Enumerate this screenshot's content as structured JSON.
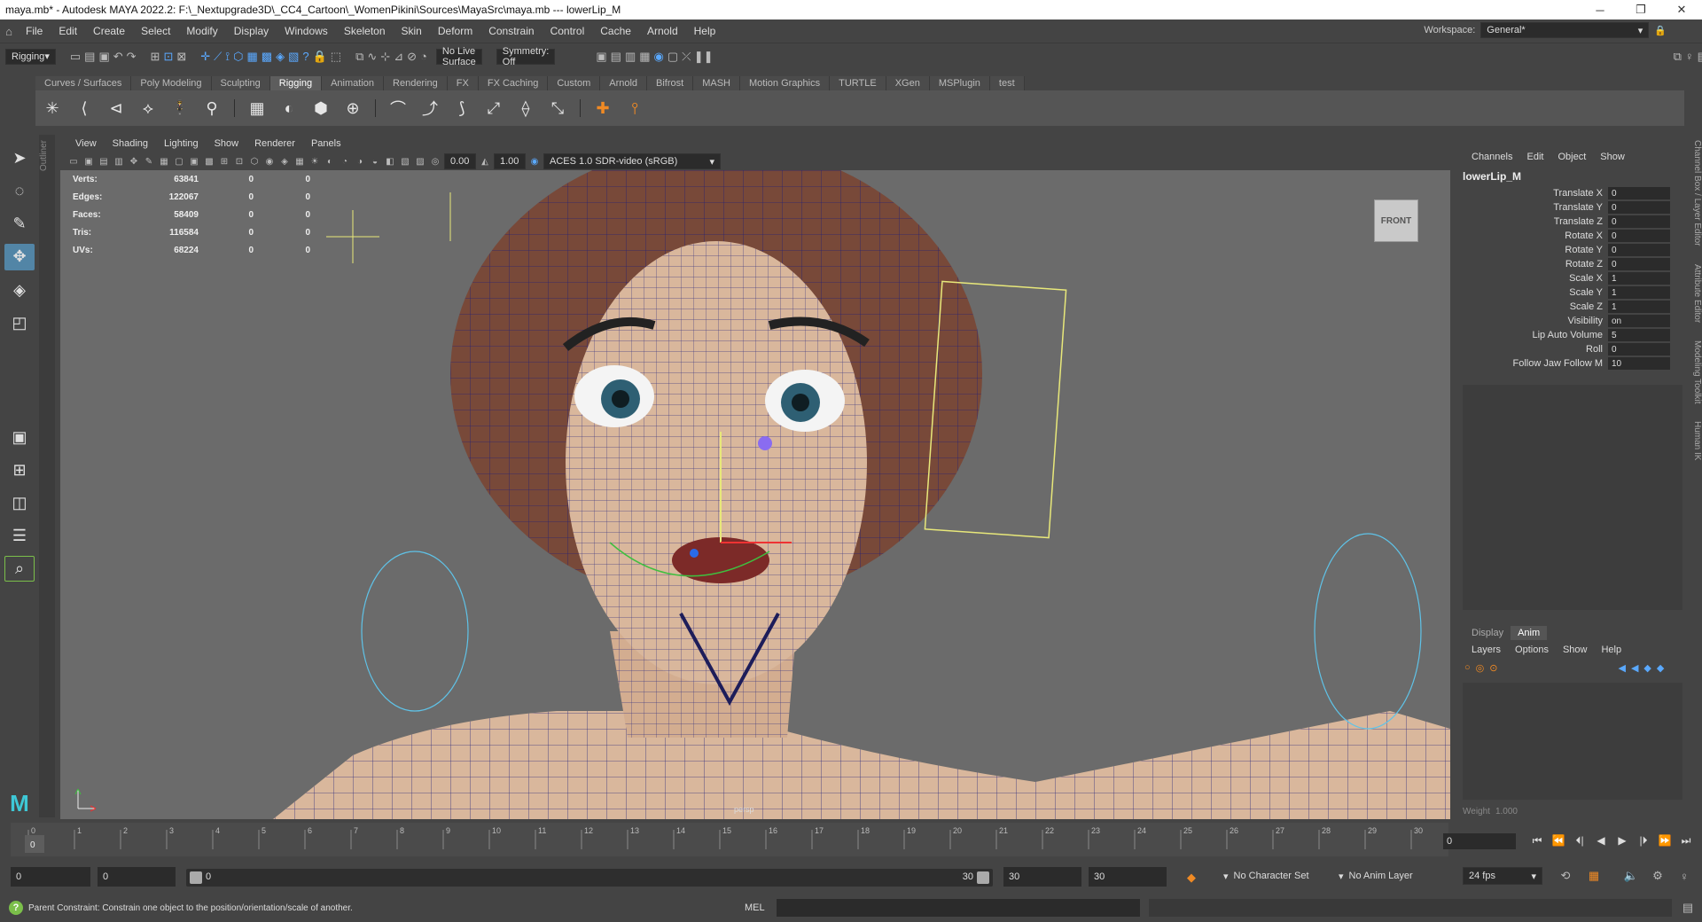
{
  "titlebar": {
    "title": "maya.mb* - Autodesk MAYA 2022.2: F:\\_Nextupgrade3D\\_CC4_Cartoon\\_WomenPikini\\Sources\\MayaSrc\\maya.mb   ---   lowerLip_M",
    "min": "─",
    "max": "❐",
    "close": "✕"
  },
  "menu": [
    "File",
    "Edit",
    "Create",
    "Select",
    "Modify",
    "Display",
    "Windows",
    "Skeleton",
    "Skin",
    "Deform",
    "Constrain",
    "Control",
    "Cache",
    "Arnold",
    "Help"
  ],
  "workspace": {
    "label": "Workspace:",
    "value": "General*"
  },
  "status": {
    "mode": "Rigging",
    "live_surface": "No Live Surface",
    "symmetry": "Symmetry: Off"
  },
  "shelf_tabs": [
    "Curves / Surfaces",
    "Poly Modeling",
    "Sculpting",
    "Rigging",
    "Animation",
    "Rendering",
    "FX",
    "FX Caching",
    "Custom",
    "Arnold",
    "Bifrost",
    "MASH",
    "Motion Graphics",
    "TURTLE",
    "XGen",
    "MSPlugin",
    "test"
  ],
  "shelf_active": "Rigging",
  "outliner_label": "Outliner",
  "panel_menu": [
    "View",
    "Shading",
    "Lighting",
    "Show",
    "Renderer",
    "Panels"
  ],
  "panel_toolbar": {
    "exposure": "0.00",
    "gamma": "1.00",
    "colorspace": "ACES 1.0 SDR-video (sRGB)"
  },
  "hud": [
    {
      "label": "Verts:",
      "a": "63841",
      "b": "0",
      "c": "0"
    },
    {
      "label": "Edges:",
      "a": "122067",
      "b": "0",
      "c": "0"
    },
    {
      "label": "Faces:",
      "a": "58409",
      "b": "0",
      "c": "0"
    },
    {
      "label": "Tris:",
      "a": "116584",
      "b": "0",
      "c": "0"
    },
    {
      "label": "UVs:",
      "a": "68224",
      "b": "0",
      "c": "0"
    }
  ],
  "viewcube": "FRONT",
  "camera": "persp",
  "channelbox": {
    "tabs": [
      "Channels",
      "Edit",
      "Object",
      "Show"
    ],
    "object": "lowerLip_M",
    "attrs": [
      {
        "name": "Translate X",
        "value": "0"
      },
      {
        "name": "Translate Y",
        "value": "0"
      },
      {
        "name": "Translate Z",
        "value": "0"
      },
      {
        "name": "Rotate X",
        "value": "0"
      },
      {
        "name": "Rotate Y",
        "value": "0"
      },
      {
        "name": "Rotate Z",
        "value": "0"
      },
      {
        "name": "Scale X",
        "value": "1"
      },
      {
        "name": "Scale Y",
        "value": "1"
      },
      {
        "name": "Scale Z",
        "value": "1"
      },
      {
        "name": "Visibility",
        "value": "on"
      },
      {
        "name": "Lip Auto Volume",
        "value": "5"
      },
      {
        "name": "Roll",
        "value": "0"
      },
      {
        "name": "Follow Jaw Follow M",
        "value": "10"
      }
    ]
  },
  "side_tabs": [
    "Channel Box / Layer Editor",
    "Attribute Editor",
    "Modeling Toolkit",
    "Human IK"
  ],
  "layers": {
    "tabs": [
      "Display",
      "Anim"
    ],
    "active": "Anim",
    "menu": [
      "Layers",
      "Options",
      "Show",
      "Help"
    ],
    "weight_label": "Weight",
    "weight_value": "1.000"
  },
  "timeline": {
    "ticks": [
      "0",
      "1",
      "2",
      "3",
      "4",
      "5",
      "6",
      "7",
      "8",
      "9",
      "10",
      "11",
      "12",
      "13",
      "14",
      "15",
      "16",
      "17",
      "18",
      "19",
      "20",
      "21",
      "22",
      "23",
      "24",
      "25",
      "26",
      "27",
      "28",
      "29",
      "30"
    ],
    "current": "0"
  },
  "current_frame": "0",
  "playback": [
    "⏮",
    "⏪",
    "⏴|",
    "◀",
    "▶",
    "|⏵",
    "⏩",
    "⏭"
  ],
  "range": {
    "start": "0",
    "inner_start": "0",
    "slider_left": "0",
    "slider_right": "30",
    "inner_end": "30",
    "end": "30"
  },
  "char_set": "No Character Set",
  "anim_layer": "No Anim Layer",
  "fps": "24 fps",
  "help_text": "Parent Constraint: Constrain one object to the position/orientation/scale of another.",
  "mel_label": "MEL",
  "colors": {
    "accent": "#5285a6",
    "wire": "#1d1d7a",
    "skin": "#d9b79c",
    "hair": "#7a4330",
    "bg": "#6b6b6b"
  }
}
